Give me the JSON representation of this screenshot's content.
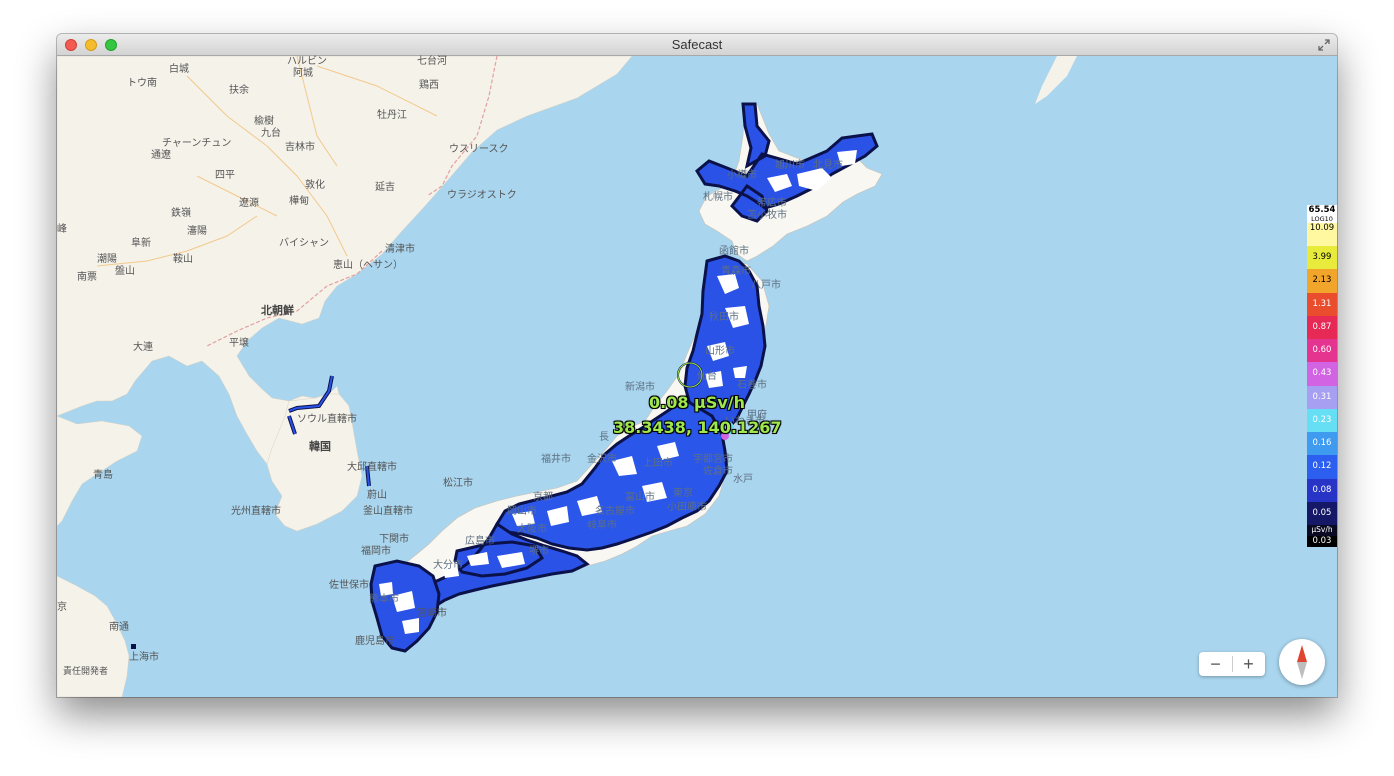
{
  "window": {
    "title": "Safecast"
  },
  "readout": {
    "dose": "0.08 µSv/h",
    "coords": "38.3438, 140.1267"
  },
  "legend": {
    "max": "65.54",
    "scale": "LOG10",
    "unit": "µSv/h",
    "min": "0.03",
    "stops": [
      "10.09",
      "3.99",
      "2.13",
      "1.31",
      "0.87",
      "0.60",
      "0.43",
      "0.31",
      "0.23",
      "0.16",
      "0.12",
      "0.08",
      "0.05"
    ],
    "colors": [
      "#fff8a0",
      "#e8ea3c",
      "#f2a52b",
      "#ea4d2d",
      "#e62a55",
      "#e5348f",
      "#d264e3",
      "#a79ff2",
      "#66def3",
      "#3e9bef",
      "#2c5ef0",
      "#2734c6",
      "#151866"
    ]
  },
  "zoom": {
    "minus": "−",
    "plus": "+"
  },
  "attribution": "責任開発者",
  "labels": {
    "hakujo": "白城",
    "harbin": "ハルビン",
    "achengs": "阿城",
    "shichitaiga": "七台河",
    "keisei": "鶏西",
    "tounan": "トウ南",
    "fuyo": "扶余",
    "yushu": "楡樹",
    "kyudai": "九台",
    "botankou": "牡丹江",
    "chahar": "チャーンチュン",
    "kitsurin": "吉林市",
    "tsuryo": "通遼",
    "ussuri": "ウスリースク",
    "shihei": "四平",
    "tonka": "敦化",
    "enkichi": "延吉",
    "ryogen": "遼源",
    "kaden": "樺甸",
    "vladi": "ウラジオストク",
    "tetsurei": "鉄嶺",
    "shinyo": "瀋陽",
    "fushin": "阜新",
    "ho": "峰",
    "koyo": "潮陽",
    "chozan": "鞍山",
    "baishan": "バイシャン",
    "seishin": "清津市",
    "eizan": "恵山（ヘサン）",
    "nanpyo": "南票",
    "bansan": "盤山",
    "kitachosen": "北朝鮮",
    "dairen": "大連",
    "heijo": "平壌",
    "seoul": "ソウル直轄市",
    "kankoku": "韓国",
    "taegu": "大邱直轄市",
    "ulsan": "蔚山",
    "busan": "釜山直轄市",
    "gwangju": "光州直轄市",
    "seito": "青島",
    "nankin": "京",
    "nantsu": "南通",
    "shanghai": "上海市",
    "asahikawa": "旭川市",
    "kitami": "北見市",
    "otaru": "小樽市",
    "sapporo": "札幌市",
    "obihiro": "帯広市",
    "tomakomai": "苫小牧市",
    "hakodate": "函館市",
    "aomori": "青森市",
    "hachinohe": "八戸市",
    "akita": "秋田市",
    "yamagata": "山形市",
    "sendai": "仙台",
    "ishinomaki": "石巻市",
    "niigata": "新潟市",
    "iwaki": "いわき市",
    "utsunomiya": "宇都宮市",
    "mito": "水戸",
    "nagano": "長",
    "fukui": "福井市",
    "kanazawa": "金沢市",
    "kofu": "甲府",
    "toyama": "富山市",
    "ueda": "上田市",
    "tokyo": "東京",
    "sakura": "佐倉市",
    "kyoto": "京都",
    "okayama": "岡山市",
    "osaka": "大阪市",
    "hamamatsu": "浜松市",
    "hiroshima": "広島市",
    "sakai": "堺市",
    "odawara": "小田原市",
    "matsue": "松江市",
    "shimonoseki": "下関市",
    "fukuoka": "福岡市",
    "oita": "大分市",
    "sasebo": "佐世保市",
    "kumamoto": "熊本市",
    "miyazaki": "宮崎市",
    "kagoshima": "鹿児島市",
    "toyohashi": "岐阜市",
    "nagoya": "名古屋市"
  }
}
